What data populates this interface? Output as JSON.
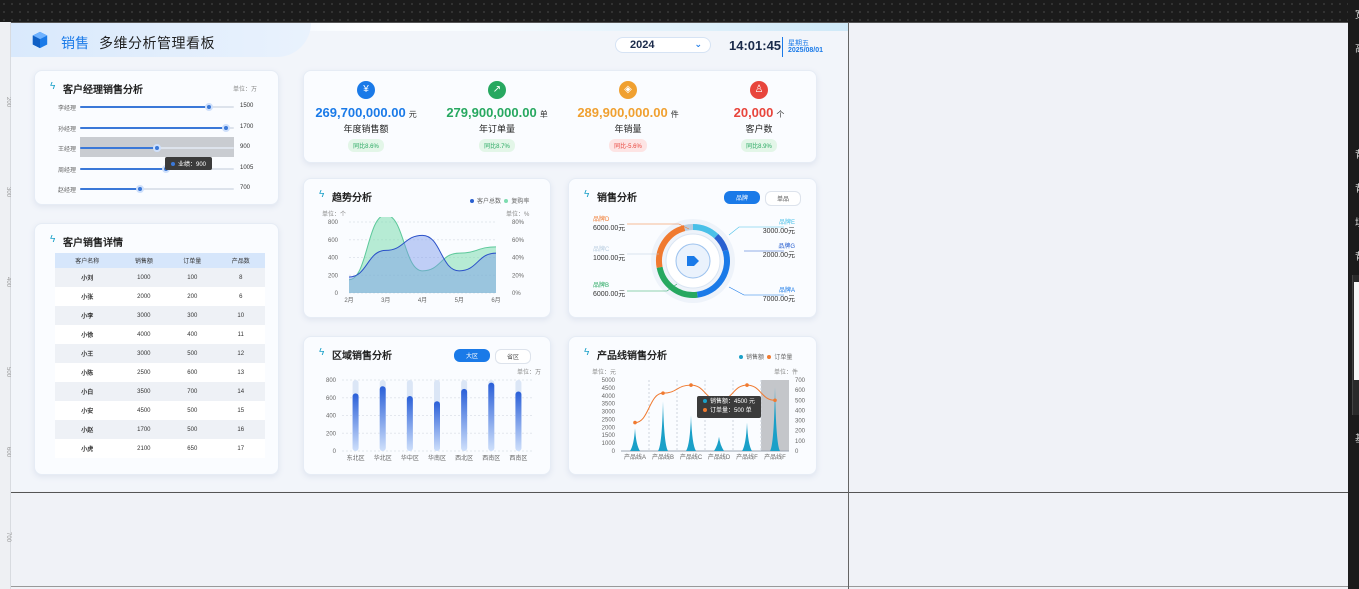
{
  "header": {
    "brand": "销售",
    "title": "多维分析管理看板",
    "year": "2024",
    "time": "14:01:45",
    "weekday": "星期五",
    "date": "2025/08/01"
  },
  "colors": {
    "accent": "#1a7ae8",
    "green": "#27a860",
    "orange": "#f0a030",
    "red": "#e8453c"
  },
  "manager": {
    "title": "客户经理销售分析",
    "unit": "单位：万",
    "rows": [
      {
        "label": "李经理",
        "value": "1500",
        "fraction": 0.84
      },
      {
        "label": "孙经理",
        "value": "1700",
        "fraction": 0.95
      },
      {
        "label": "王经理",
        "value": "900",
        "fraction": 0.5
      },
      {
        "label": "周经理",
        "value": "1005",
        "fraction": 0.56
      },
      {
        "label": "赵经理",
        "value": "700",
        "fraction": 0.39
      }
    ],
    "tooltip": "业绩：900"
  },
  "detail": {
    "title": "客户销售详情",
    "headers": [
      "客户名称",
      "销售额",
      "订单量",
      "产品数"
    ],
    "rows": [
      [
        "小刘",
        "1000",
        "100",
        "8"
      ],
      [
        "小张",
        "2000",
        "200",
        "6"
      ],
      [
        "小李",
        "3000",
        "300",
        "10"
      ],
      [
        "小徐",
        "4000",
        "400",
        "11"
      ],
      [
        "小王",
        "3000",
        "500",
        "12"
      ],
      [
        "小陈",
        "2500",
        "600",
        "13"
      ],
      [
        "小白",
        "3500",
        "700",
        "14"
      ],
      [
        "小安",
        "4500",
        "500",
        "15"
      ],
      [
        "小赵",
        "1700",
        "500",
        "16"
      ],
      [
        "小虎",
        "2100",
        "650",
        "17"
      ]
    ]
  },
  "kpis": [
    {
      "icon": "¥",
      "value": "269,700,000.00",
      "unit": "元",
      "label": "年度销售额",
      "yoy": "同比8.6%",
      "color": "#1a7ae8",
      "yoyBg": "#e3f6e8",
      "yoyColor": "#27a860"
    },
    {
      "icon": "↗",
      "value": "279,900,000.00",
      "unit": "单",
      "label": "年订单量",
      "yoy": "同比8.7%",
      "color": "#27a860",
      "yoyBg": "#e3f6e8",
      "yoyColor": "#27a860"
    },
    {
      "icon": "◈",
      "value": "289,900,000.00",
      "unit": "件",
      "label": "年销量",
      "yoy": "同比-5.6%",
      "color": "#f0a030",
      "yoyBg": "#fde4e4",
      "yoyColor": "#e8453c"
    },
    {
      "icon": "♙",
      "value": "20,000",
      "unit": "个",
      "label": "客户数",
      "yoy": "同比8.9%",
      "color": "#e8453c",
      "yoyBg": "#e3f6e8",
      "yoyColor": "#27a860"
    }
  ],
  "trend": {
    "title": "趋势分析",
    "legend": [
      "客户总数",
      "复购率"
    ],
    "unit_left": "单位：个",
    "unit_right": "单位：%",
    "chart_data": {
      "type": "area",
      "categories": [
        "2月",
        "3月",
        "4月",
        "5月",
        "6月"
      ],
      "series": [
        {
          "name": "客户总数",
          "values": [
            180,
            480,
            650,
            250,
            450
          ],
          "axis": "left"
        },
        {
          "name": "复购率",
          "values": [
            15,
            88,
            25,
            45,
            52
          ],
          "axis": "right"
        }
      ],
      "ylim_left": [
        0,
        800
      ],
      "ylim_right": [
        0,
        80
      ],
      "yticks_left": [
        "0",
        "200",
        "400",
        "600",
        "800"
      ],
      "yticks_right": [
        "0%",
        "20%",
        "40%",
        "60%",
        "80%"
      ]
    }
  },
  "salesPie": {
    "title": "销售分析",
    "toggles": [
      "品牌",
      "单品"
    ],
    "chart_data": {
      "type": "pie",
      "slices": [
        {
          "label": "品牌D",
          "value": 6000,
          "text": "6000.00元",
          "color": "#f07a30"
        },
        {
          "label": "品牌C",
          "value": 1000,
          "text": "1000.00元",
          "color": "#b9cde0"
        },
        {
          "label": "品牌B",
          "value": 6000,
          "text": "6000.00元",
          "color": "#27a860"
        },
        {
          "label": "品牌E",
          "value": 3000,
          "text": "3000.00元",
          "color": "#4ac0e8"
        },
        {
          "label": "品牌G",
          "value": 2000,
          "text": "2000.00元",
          "color": "#2a60d0"
        },
        {
          "label": "品牌A",
          "value": 7000,
          "text": "7000.00元",
          "color": "#1a7ae8"
        }
      ]
    }
  },
  "region": {
    "title": "区域销售分析",
    "toggles": [
      "大区",
      "省区"
    ],
    "unit": "单位：万",
    "chart_data": {
      "type": "bar",
      "categories": [
        "东北区",
        "华北区",
        "华中区",
        "华南区",
        "西北区",
        "西南区",
        "西南区"
      ],
      "values": [
        650,
        730,
        620,
        560,
        700,
        770,
        670
      ],
      "ylim": [
        0,
        800
      ],
      "yticks": [
        "0",
        "200",
        "400",
        "600",
        "800"
      ]
    }
  },
  "product": {
    "title": "产品线销售分析",
    "legend": [
      "销售额",
      "订单量"
    ],
    "unit_left": "单位：元",
    "unit_right": "单位：件",
    "tooltip": [
      "销售额：4500 元",
      "订单量：500 单"
    ],
    "chart_data": {
      "type": "bar",
      "categories": [
        "产品线A",
        "产品线B",
        "产品线C",
        "产品线D",
        "产品线F",
        "产品线F"
      ],
      "series": [
        {
          "name": "销售额",
          "values": [
            1600,
            3500,
            2500,
            1000,
            2000,
            4500
          ],
          "axis": "left"
        },
        {
          "name": "订单量",
          "values": [
            280,
            570,
            650,
            500,
            650,
            500
          ],
          "axis": "right"
        }
      ],
      "ylim_left": [
        0,
        5000
      ],
      "ylim_right": [
        0,
        700
      ],
      "yticks_left": [
        "0",
        "1000",
        "1500",
        "2000",
        "2500",
        "3000",
        "3500",
        "4000",
        "4500",
        "5000"
      ],
      "yticks_right": [
        "0",
        "100",
        "200",
        "300",
        "400",
        "500",
        "600",
        "700"
      ]
    }
  },
  "editor": {
    "ruler": [
      "200",
      "300",
      "400",
      "500",
      "600",
      "700"
    ],
    "side": [
      "宽",
      "高",
      "背",
      "背",
      "填",
      "背",
      "基"
    ]
  }
}
